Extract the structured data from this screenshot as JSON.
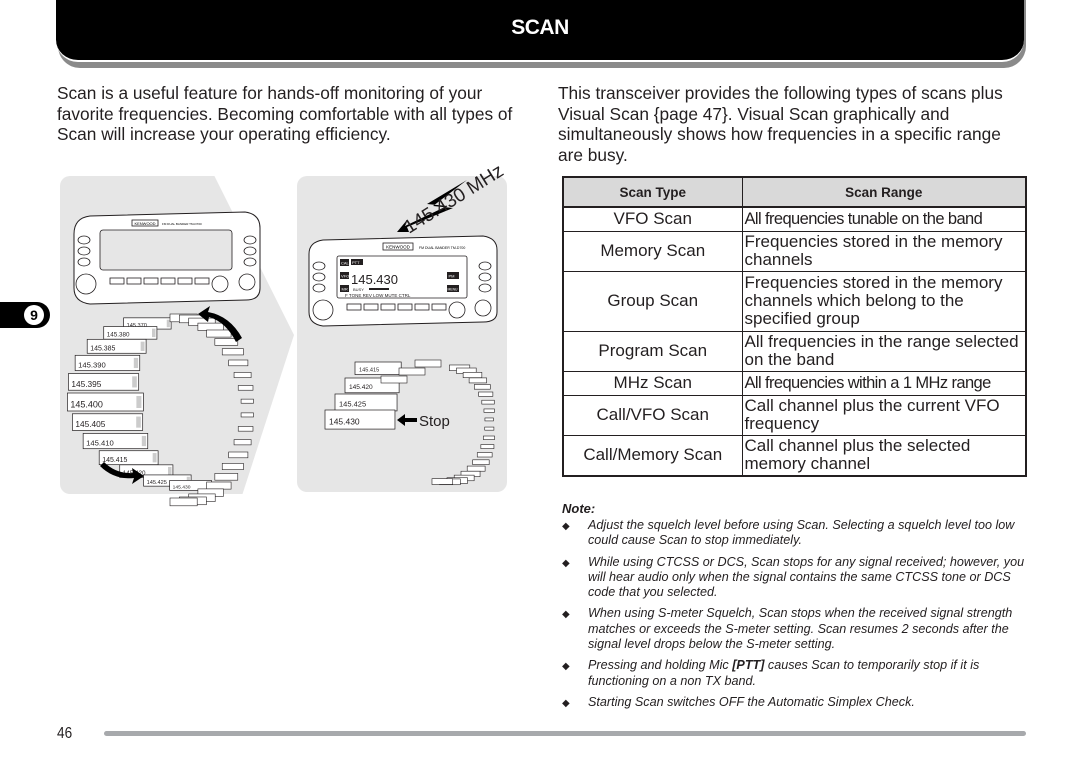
{
  "header": {
    "title": "SCAN"
  },
  "chapter_tab": {
    "number": "9"
  },
  "intro": {
    "left": "Scan is a useful feature for hands-off monitoring of your favorite frequencies.  Becoming comfortable with all types of Scan will increase your operating efficiency.",
    "right": "This transceiver provides the following types of scans plus Visual Scan {page 47}.  Visual Scan graphically and simultaneously shows how frequencies in a specific range are busy."
  },
  "illustration_left": {
    "frequencies": [
      "145.370",
      "145.380",
      "145.385",
      "145.390",
      "145.395",
      "145.400",
      "145.405",
      "145.410",
      "145.415",
      "145.420",
      "145.425",
      "145.430"
    ],
    "radio_brand": "KENWOOD",
    "radio_model": "FM DUAL BANDER TM-D700"
  },
  "illustration_right": {
    "signal_label": "145.430 MHz",
    "display_freq": "145.430",
    "display_tags": [
      "CALL",
      "VFO",
      "MR",
      "PM",
      "MENU",
      "PTT"
    ],
    "display_soft_keys": "F   TONE  REV  LOW  MUTE CTRL",
    "display_busy": "BUSY",
    "stack_frequencies": [
      "145.415",
      "145.420",
      "145.425",
      "145.430"
    ],
    "stop_label": "Stop",
    "radio_brand": "KENWOOD",
    "radio_model": "FM DUAL BANDER TM-D700"
  },
  "table": {
    "headers": [
      "Scan Type",
      "Scan Range"
    ],
    "rows": [
      {
        "type": "VFO Scan",
        "range": "All frequencies tunable on the band"
      },
      {
        "type": "Memory Scan",
        "range": "Frequencies stored in the memory channels"
      },
      {
        "type": "Group Scan",
        "range": "Frequencies stored in the memory channels which belong to the specified group"
      },
      {
        "type": "Program Scan",
        "range": "All frequencies in the range selected on the band"
      },
      {
        "type": "MHz Scan",
        "range": "All frequencies within a 1 MHz range"
      },
      {
        "type": "Call/VFO Scan",
        "range": "Call channel plus the current VFO frequency"
      },
      {
        "type": "Call/Memory Scan",
        "range": "Call channel plus the selected memory channel"
      }
    ]
  },
  "notes": {
    "title": "Note:",
    "bullet": "◆",
    "items": [
      {
        "pre": "Adjust the squelch level before using Scan.  Selecting a squelch level too low could cause Scan to stop immediately.",
        "bold": "",
        "post": ""
      },
      {
        "pre": "While using CTCSS or DCS, Scan stops for any signal received; however, you will hear audio only when the signal contains the same CTCSS tone or DCS code that you selected.",
        "bold": "",
        "post": ""
      },
      {
        "pre": "When using S-meter Squelch, Scan stops when the received signal strength matches or exceeds the S-meter setting.  Scan resumes 2 seconds after the signal level drops below the S-meter setting.",
        "bold": "",
        "post": ""
      },
      {
        "pre": "Pressing and holding Mic ",
        "bold": "[PTT]",
        "post": " causes Scan to temporarily stop if it is functioning on a non TX band."
      },
      {
        "pre": "Starting Scan switches OFF the Automatic Simplex Check.",
        "bold": "",
        "post": ""
      }
    ]
  },
  "footer": {
    "page_number": "46"
  }
}
